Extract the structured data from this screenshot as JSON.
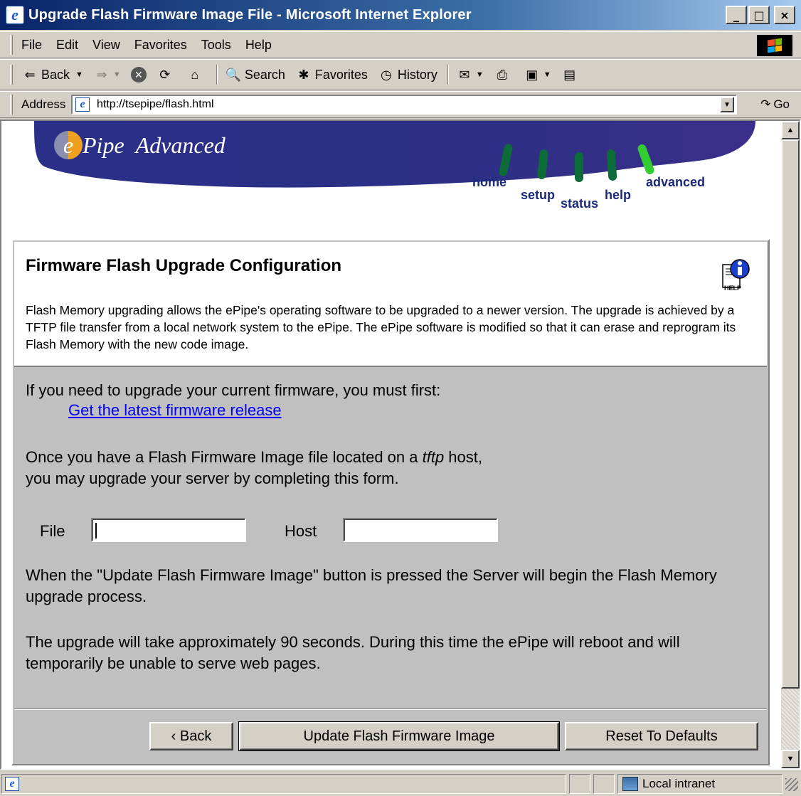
{
  "window": {
    "title": "Upgrade Flash Firmware Image File - Microsoft Internet Explorer",
    "controls": {
      "minimize": "_",
      "maximize": "□",
      "close": "×"
    }
  },
  "menu": [
    "File",
    "Edit",
    "View",
    "Favorites",
    "Tools",
    "Help"
  ],
  "toolbar": {
    "back": "Back",
    "search": "Search",
    "favorites": "Favorites",
    "history": "History"
  },
  "address": {
    "label": "Address",
    "url": "http://tsepipe/flash.html",
    "go": "Go"
  },
  "banner": {
    "logo_e": "e",
    "logo_pipe": "Pipe",
    "logo_advanced": "Advanced",
    "nav": [
      "home",
      "setup",
      "status",
      "help",
      "advanced"
    ]
  },
  "panel": {
    "title": "Firmware Flash Upgrade Configuration",
    "help_icon_label": "HELP",
    "description": "Flash Memory upgrading allows the ePipe's operating software to be upgraded to a newer version. The upgrade is achieved by a TFTP file transfer from a local network system to the ePipe. The ePipe software is modified so that it can erase and reprogram its Flash Memory with the new code image.",
    "intro": "If you need to upgrade your current firmware, you must first:",
    "link": "Get the latest firmware release",
    "tftp_line1_pre": "Once you have a Flash Firmware Image file located on a ",
    "tftp_word": "tftp",
    "tftp_line1_post": " host,",
    "tftp_line2": "you may upgrade your server by completing this form.",
    "file_label": "File",
    "file_value": "",
    "host_label": "Host",
    "host_value": "",
    "update_note": "When the \"Update Flash Firmware Image\" button is pressed the Server will begin the Flash Memory upgrade process.",
    "time_note": "The upgrade will take approximately 90 seconds. During this time the ePipe will reboot and will temporarily be unable to serve web pages.",
    "buttons": {
      "back": "‹ Back",
      "update": "Update Flash Firmware Image",
      "reset": "Reset To Defaults"
    }
  },
  "status": {
    "zone": "Local intranet"
  },
  "colors": {
    "banner_blue": "#2b2f8a",
    "nav_green": "#0d6b3a",
    "nav_active": "#33cc33",
    "link": "#0000ff"
  }
}
